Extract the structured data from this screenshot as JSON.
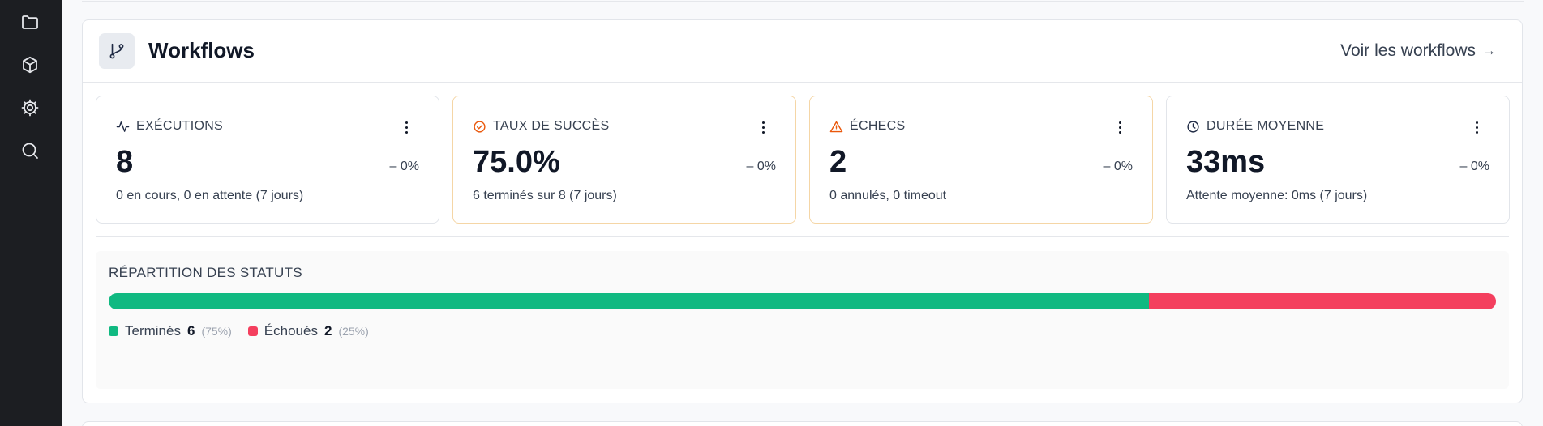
{
  "sidebar": {
    "items": [
      {
        "icon": "folder-icon"
      },
      {
        "icon": "cube-icon"
      },
      {
        "icon": "gear-icon"
      },
      {
        "icon": "search-icon"
      }
    ]
  },
  "card": {
    "title": "Workflows",
    "icon": "git-branch-icon",
    "link_label": "Voir les workflows",
    "link_arrow": "→"
  },
  "stats": [
    {
      "label": "EXÉCUTIONS",
      "icon": "activity-icon",
      "value": "8",
      "delta": "– 0%",
      "sub": "0 en cours, 0 en attente (7 jours)"
    },
    {
      "label": "TAUX DE SUCCÈS",
      "icon": "check-circle-icon",
      "value": "75.0%",
      "delta": "– 0%",
      "sub": "6 terminés sur 8 (7 jours)"
    },
    {
      "label": "ÉCHECS",
      "icon": "alert-triangle-icon",
      "value": "2",
      "delta": "– 0%",
      "sub": "0 annulés, 0 timeout"
    },
    {
      "label": "DURÉE MOYENNE",
      "icon": "clock-icon",
      "value": "33ms",
      "delta": "– 0%",
      "sub": "Attente moyenne: 0ms (7 jours)"
    }
  ],
  "distribution": {
    "title": "RÉPARTITION DES STATUTS",
    "segments": [
      {
        "name": "Terminés",
        "count": "6",
        "pct": "(75%)",
        "fraction": 0.75,
        "color": "#10b981"
      },
      {
        "name": "Échoués",
        "count": "2",
        "pct": "(25%)",
        "fraction": 0.25,
        "color": "#f43f5e"
      }
    ]
  },
  "colors": {
    "sidebar_bg": "#1c1e22",
    "warning_accent": "#ea580c",
    "warn_border": "#f5d6a6"
  }
}
